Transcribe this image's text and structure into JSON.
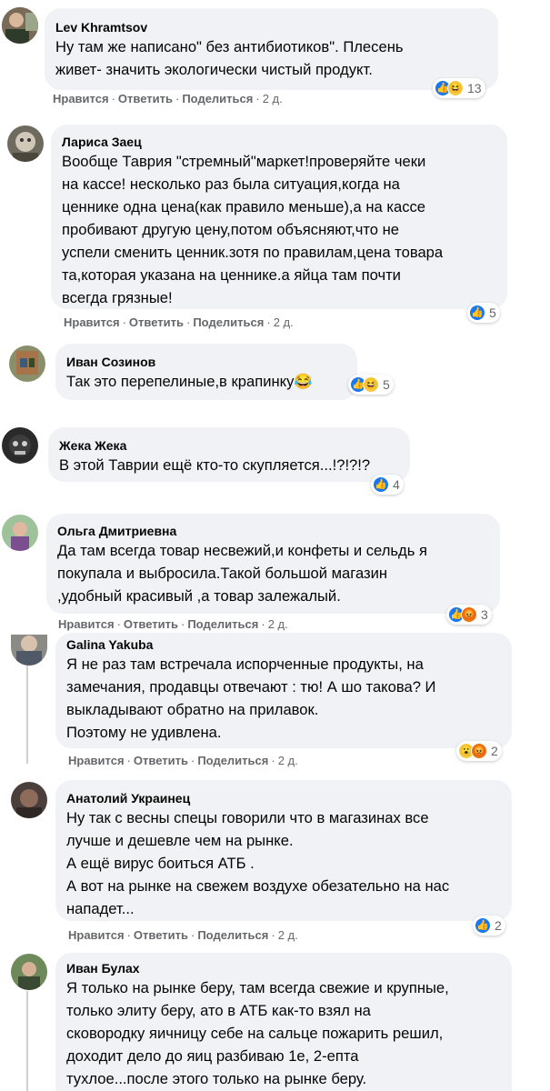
{
  "actions": {
    "like": "Нравится",
    "reply": "Ответить",
    "share": "Поделиться",
    "sep": "·"
  },
  "reaction_icons": {
    "like": "thumbs-up-icon",
    "haha": "laughing-face-icon",
    "angry": "angry-face-icon",
    "wow": "surprised-face-icon"
  },
  "colors": {
    "bubble": "#f0f2f5",
    "like_blue": "#1877f2",
    "muted": "#65676b"
  },
  "comments": [
    {
      "author": "Lev Khramtsov",
      "lines": [
        "Ну там же написано\" без антибиотиков\". Плесень",
        "живет- значить экологически чистый продукт."
      ],
      "time": "2 д.",
      "reaction_count": "13"
    },
    {
      "author": "Лариса Заец",
      "lines": [
        "Вообще Таврия \"стремный\"маркет!проверяйте чеки",
        "на кассе! несколько раз была ситуация,когда на",
        "ценнике одна цена(как правило меньше),а на кассе",
        "пробивают другую цену,потом объясняют,что не",
        "успели сменить ценник.зотя по правилам,цена товара",
        "та,которая указана на ценнике.а яйца там почти",
        "всегда грязные!"
      ],
      "time": "2 д.",
      "reaction_count": "5"
    },
    {
      "author": "Иван Созинов",
      "lines": [
        "Так это перепелиные,в крапинку😂"
      ],
      "reaction_count": "5"
    },
    {
      "author": "Жека Жека",
      "lines": [
        "В этой Таврии ещё кто-то скупляется...!?!?!?"
      ],
      "reaction_count": "4"
    },
    {
      "author": "Ольга Дмитриевна",
      "lines": [
        "Да там всегда товар несвежий,и конфеты и сельдь я",
        "покупала и выбросила.Такой большой магазин",
        ",удобный красивый ,а товар залежалый."
      ],
      "time": "2 д.",
      "reaction_count": "3"
    },
    {
      "author": "Galina Yakuba",
      "lines": [
        "Я не раз там встречала испорченные продукты, на",
        "замечания, продавцы отвечают : тю! А шо такова? И",
        "выкладывают обратно на прилавок.",
        "Поэтому не удивлена."
      ],
      "time": "2 д.",
      "reaction_count": "2"
    },
    {
      "author": "Анатолий Украинец",
      "lines": [
        "Ну так с весны спецы говорили что в магазинах все",
        "лучше и дешевле чем на рынке.",
        "А ещё вирус боиться АТБ .",
        "А вот на рынке на свежем воздухе обезательно на нас",
        "нападет..."
      ],
      "time": "2 д.",
      "reaction_count": "2"
    },
    {
      "author": "Иван Булах",
      "lines": [
        "Я только на рынке беру, там всегда свежие и крупные,",
        "только элиту беру, ато в АТБ как-то взял на",
        "сковородку яичницу себе на сальце пожарить решил,",
        "доходит дело до яиц разбиваю 1е, 2-епта",
        "тухлое...после этого только на рынке беру."
      ]
    }
  ]
}
